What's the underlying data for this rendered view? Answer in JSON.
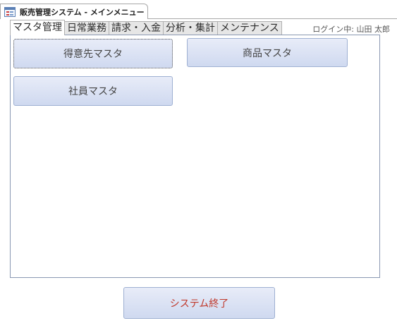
{
  "window": {
    "doc_tab_title": "販売管理システム - メインメニュー",
    "icon": "form-icon"
  },
  "module_tabs": [
    {
      "label": "マスタ管理",
      "active": true
    },
    {
      "label": "日常業務",
      "active": false
    },
    {
      "label": "請求・入金",
      "active": false
    },
    {
      "label": "分析・集計",
      "active": false
    },
    {
      "label": "メンテナンス",
      "active": false
    }
  ],
  "login": {
    "text": "ログイン中: 山田 太郎"
  },
  "panel": {
    "buttons": {
      "customer_master": "得意先マスタ",
      "product_master": "商品マスタ",
      "employee_master": "社員マスタ"
    }
  },
  "footer": {
    "exit_label": "システム終了"
  },
  "colors": {
    "button_gradient_top": "#e8ecf8",
    "button_gradient_bottom": "#cfd9f0",
    "exit_text": "#c0392b",
    "panel_border": "#8a98b2"
  }
}
